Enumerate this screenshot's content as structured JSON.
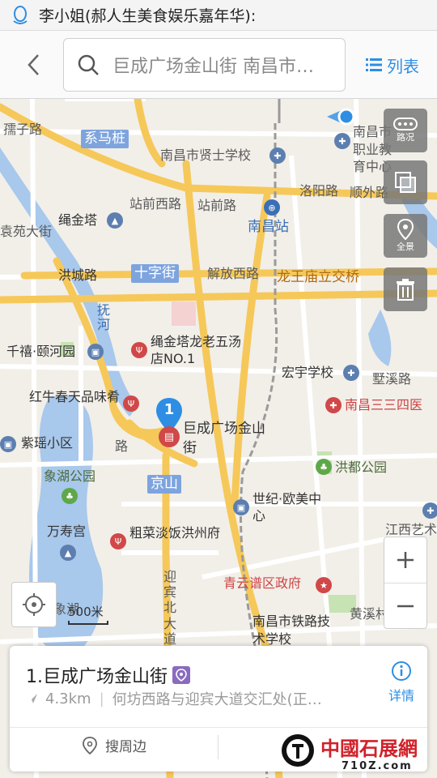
{
  "notification": {
    "text": "李小姐(郝人生美食娱乐嘉年华):"
  },
  "header": {
    "search_text": "巨成广场金山街 南昌市…",
    "list_label": "列表"
  },
  "map": {
    "labels": {
      "zhuzizai": "孺子路",
      "ximazhuang": "系马桩",
      "xianshi_school": "南昌市贤士学校",
      "zhiye_school": "南昌市职业教育中心",
      "zhanqian_west": "站前西路",
      "zhanqian": "站前路",
      "luoyang": "洛阳路",
      "shunwai": "顺外路",
      "jinta": "绳金塔",
      "yuanda": "袁苑大街",
      "nanchang_station": "南昌站",
      "hongcheng": "洪城路",
      "shizijie": "十字街",
      "jiefang_west": "解放西路",
      "longwangmiao": "龙王庙立交桥",
      "fuhe": "抚河",
      "qianqi": "千禧·颐河园",
      "jinta_hotel": "绳金塔龙老五汤店NO.1",
      "hongyu_school": "宏宇学校",
      "yexi": "墅溪路",
      "hongniu": "红牛春天品味肴",
      "sansi": "南昌三三四医",
      "zijiao": "紫瑶小区",
      "julcheng": "巨成广场金山街",
      "xianghu_park": "象湖公园",
      "hongdu_park": "洪都公园",
      "jingshan": "京山",
      "century": "世纪·欧美中心",
      "jiangxi_art": "江西艺术",
      "wanshou": "万寿宫",
      "cuchafan": "粗菜淡饭洪州府",
      "yingbin": "迎宾北大道",
      "qingyunpu": "青云谱区政府",
      "huangxi": "黄溪村",
      "tielu_school": "南昌市铁路技术学校",
      "xianghu": "象湖",
      "road_right": "路"
    },
    "marker_number": "1",
    "controls": {
      "traffic": "路况",
      "panorama": "全景"
    },
    "scale": "500米"
  },
  "card": {
    "title": "1.巨成广场金山街",
    "distance": "4.3km",
    "address": "何坊西路与迎宾大道交汇处(正…",
    "details": "详情",
    "nearby": "搜周边"
  },
  "watermark": {
    "title": "中國石展網",
    "url": "710Z.com"
  },
  "colors": {
    "accent": "#2d8ee4",
    "main_road": "#f5c859",
    "water": "#a8c8ec",
    "park": "#c7e3b3"
  }
}
